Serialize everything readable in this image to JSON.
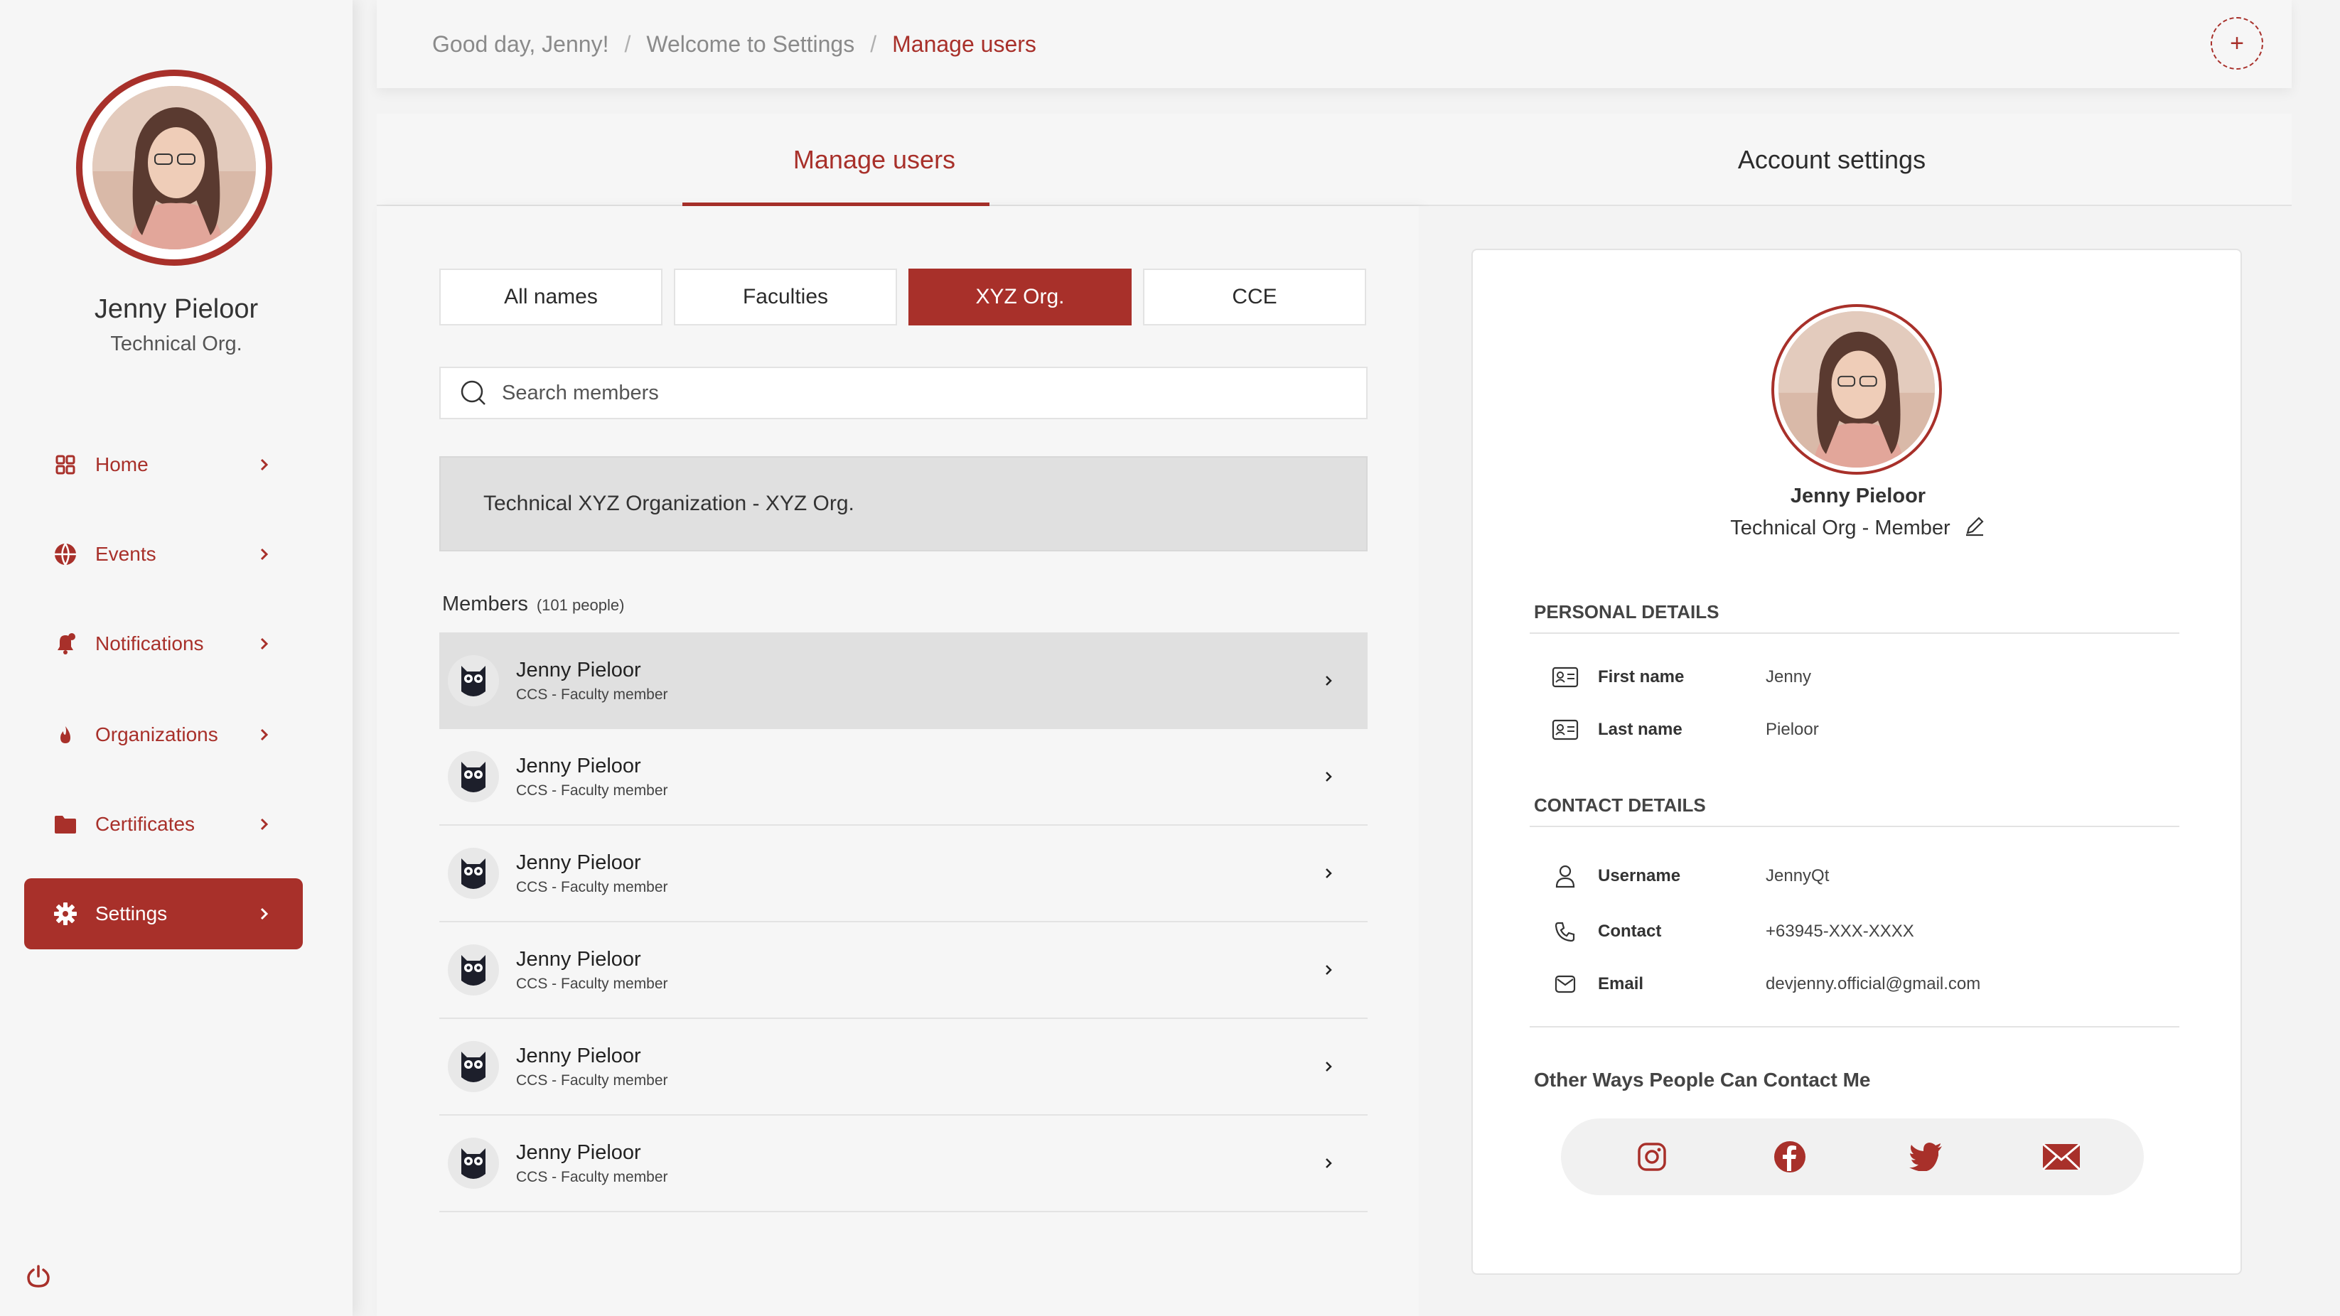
{
  "brand": {
    "accent": "#a8302a"
  },
  "profile": {
    "name": "Jenny Pieloor",
    "org": "Technical Org."
  },
  "nav": {
    "items": [
      {
        "label": "Home",
        "icon": "grid-icon"
      },
      {
        "label": "Events",
        "icon": "globe-icon"
      },
      {
        "label": "Notifications",
        "icon": "bell-icon"
      },
      {
        "label": "Organizations",
        "icon": "flame-icon"
      },
      {
        "label": "Certificates",
        "icon": "folder-icon"
      },
      {
        "label": "Settings",
        "icon": "gear-icon",
        "active": true
      }
    ]
  },
  "breadcrumb": [
    "Good day, Jenny!",
    "Welcome to Settings",
    "Manage users"
  ],
  "main_tabs": {
    "manage": "Manage users",
    "account": "Account settings"
  },
  "filters": [
    {
      "label": "All names"
    },
    {
      "label": "Faculties"
    },
    {
      "label": "XYZ Org.",
      "active": true
    },
    {
      "label": "CCE"
    }
  ],
  "search": {
    "placeholder": "Search members"
  },
  "org_banner": "Technical XYZ Organization - XYZ Org.",
  "members": {
    "label": "Members",
    "count": "(101 people)",
    "rows": [
      {
        "name": "Jenny Pieloor",
        "role": "CCS - Faculty member"
      },
      {
        "name": "Jenny Pieloor",
        "role": "CCS - Faculty member"
      },
      {
        "name": "Jenny Pieloor",
        "role": "CCS - Faculty member"
      },
      {
        "name": "Jenny Pieloor",
        "role": "CCS - Faculty member"
      },
      {
        "name": "Jenny Pieloor",
        "role": "CCS - Faculty member"
      },
      {
        "name": "Jenny Pieloor",
        "role": "CCS - Faculty member"
      }
    ]
  },
  "detail": {
    "name": "Jenny Pieloor",
    "role": "Technical Org - Member",
    "personal_title": "PERSONAL DETAILS",
    "first_name_label": "First name",
    "first_name": "Jenny",
    "last_name_label": "Last name",
    "last_name": "Pieloor",
    "contact_title": "CONTACT DETAILS",
    "username_label": "Username",
    "username": "JennyQt",
    "contact_label": "Contact",
    "contact": "+63945-XXX-XXXX",
    "email_label": "Email",
    "email": "devjenny.official@gmail.com",
    "other_title": "Other Ways People Can Contact Me",
    "socials": [
      "instagram-icon",
      "facebook-icon",
      "twitter-icon",
      "mail-icon"
    ]
  }
}
